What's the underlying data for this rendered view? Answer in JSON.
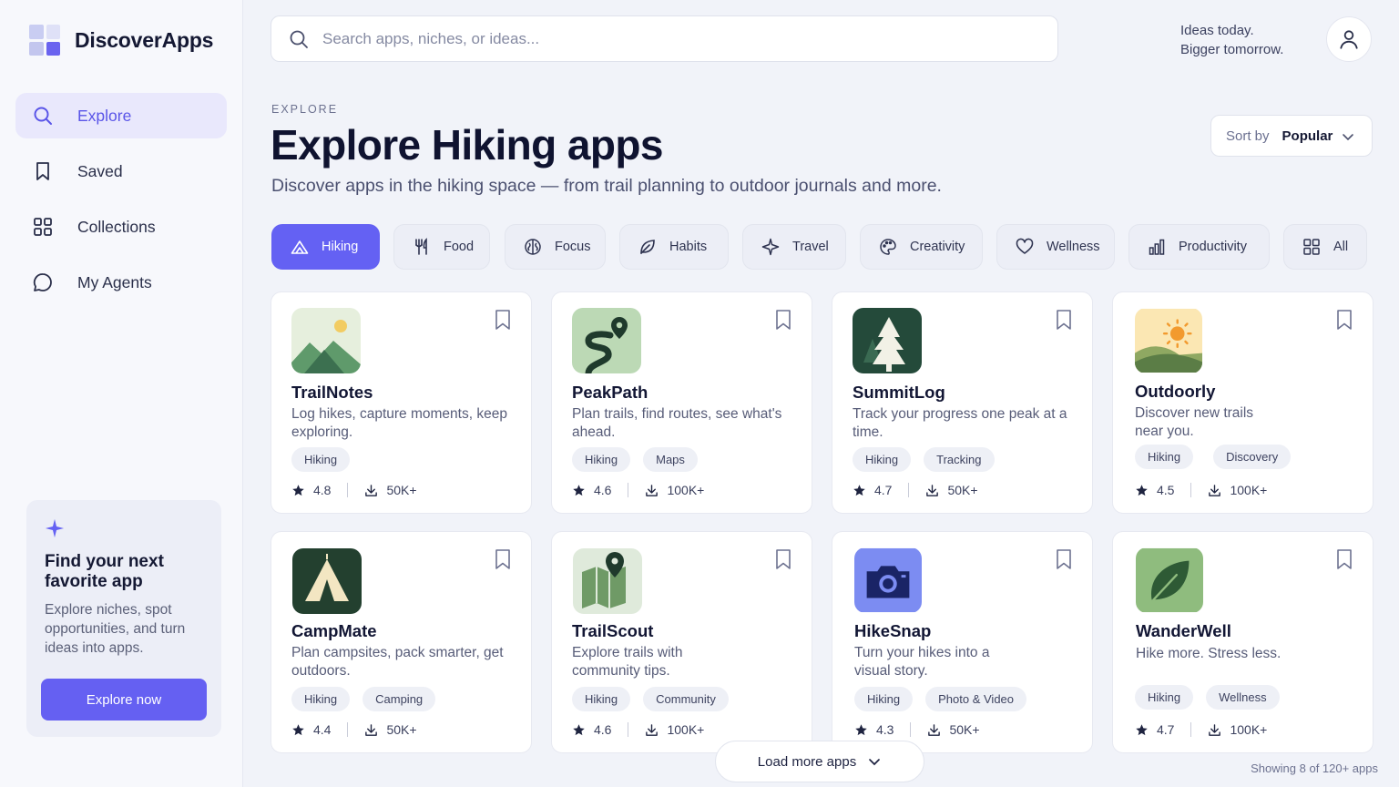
{
  "brand": {
    "name": "DiscoverApps"
  },
  "sidebar": {
    "items": [
      {
        "label": "Explore",
        "icon": "search-icon",
        "active": true
      },
      {
        "label": "Saved",
        "icon": "bookmark-icon"
      },
      {
        "label": "Collections",
        "icon": "grid-icon"
      },
      {
        "label": "My Agents",
        "icon": "chat-icon"
      }
    ],
    "promo": {
      "title": "Find your next favorite app",
      "text": "Explore niches, spot opportunities, and turn ideas into apps.",
      "button": "Explore now"
    }
  },
  "search": {
    "placeholder": "Search apps, niches, or ideas..."
  },
  "tagline": {
    "line1": "Ideas today.",
    "line2": "Bigger tomorrow."
  },
  "header": {
    "eyebrow": "EXPLORE",
    "title": "Explore Hiking apps",
    "subtitle": "Discover apps in the hiking space — from trail planning to outdoor journals and more."
  },
  "sort": {
    "label": "Sort by",
    "value": "Popular"
  },
  "chips": [
    {
      "label": "Hiking",
      "icon": "mountain-icon",
      "active": true
    },
    {
      "label": "Food",
      "icon": "utensils-icon"
    },
    {
      "label": "Focus",
      "icon": "brain-icon"
    },
    {
      "label": "Habits",
      "icon": "leaf-icon"
    },
    {
      "label": "Travel",
      "icon": "plane-icon"
    },
    {
      "label": "Creativity",
      "icon": "palette-icon"
    },
    {
      "label": "Wellness",
      "icon": "heart-icon"
    },
    {
      "label": "Productivity",
      "icon": "bar-chart-icon"
    },
    {
      "label": "All",
      "icon": "grid-icon"
    }
  ],
  "apps": [
    {
      "name": "TrailNotes",
      "desc": "Log hikes, capture moments, keep exploring.",
      "tags": [
        "Hiking"
      ],
      "rating": "4.8",
      "downloads": "50K+",
      "icon": "mountain-sun-icon"
    },
    {
      "name": "PeakPath",
      "desc": "Plan trails, find routes, see what's ahead.",
      "tags": [
        "Hiking",
        "Maps"
      ],
      "rating": "4.6",
      "downloads": "100K+",
      "icon": "route-pin-icon"
    },
    {
      "name": "SummitLog",
      "desc": "Track your progress one peak at a time.",
      "tags": [
        "Hiking",
        "Tracking"
      ],
      "rating": "4.7",
      "downloads": "50K+",
      "icon": "pine-tree-icon"
    },
    {
      "name": "Outdoorly",
      "desc": "Discover new trails near you.",
      "tags": [
        "Hiking",
        "Discovery"
      ],
      "rating": "4.5",
      "downloads": "100K+",
      "icon": "sun-hills-icon"
    },
    {
      "name": "CampMate",
      "desc": "Plan campsites, pack smarter, get outdoors.",
      "tags": [
        "Hiking",
        "Camping"
      ],
      "rating": "4.4",
      "downloads": "50K+",
      "icon": "tent-icon"
    },
    {
      "name": "TrailScout",
      "desc": "Explore trails with community tips.",
      "tags": [
        "Hiking",
        "Community"
      ],
      "rating": "4.6",
      "downloads": "100K+",
      "icon": "map-pin-icon"
    },
    {
      "name": "HikeSnap",
      "desc": "Turn your hikes into a visual story.",
      "tags": [
        "Hiking",
        "Photo & Video"
      ],
      "rating": "4.3",
      "downloads": "50K+",
      "icon": "camera-icon"
    },
    {
      "name": "WanderWell",
      "desc": "Hike more. Stress less.",
      "tags": [
        "Hiking",
        "Wellness"
      ],
      "rating": "4.7",
      "downloads": "100K+",
      "icon": "leaf-icon"
    }
  ],
  "load_more": "Load more apps",
  "showing": "Showing 8 of 120+ apps",
  "colors": {
    "accent": "#6461f3",
    "accent_soft": "#e9e8fc"
  }
}
